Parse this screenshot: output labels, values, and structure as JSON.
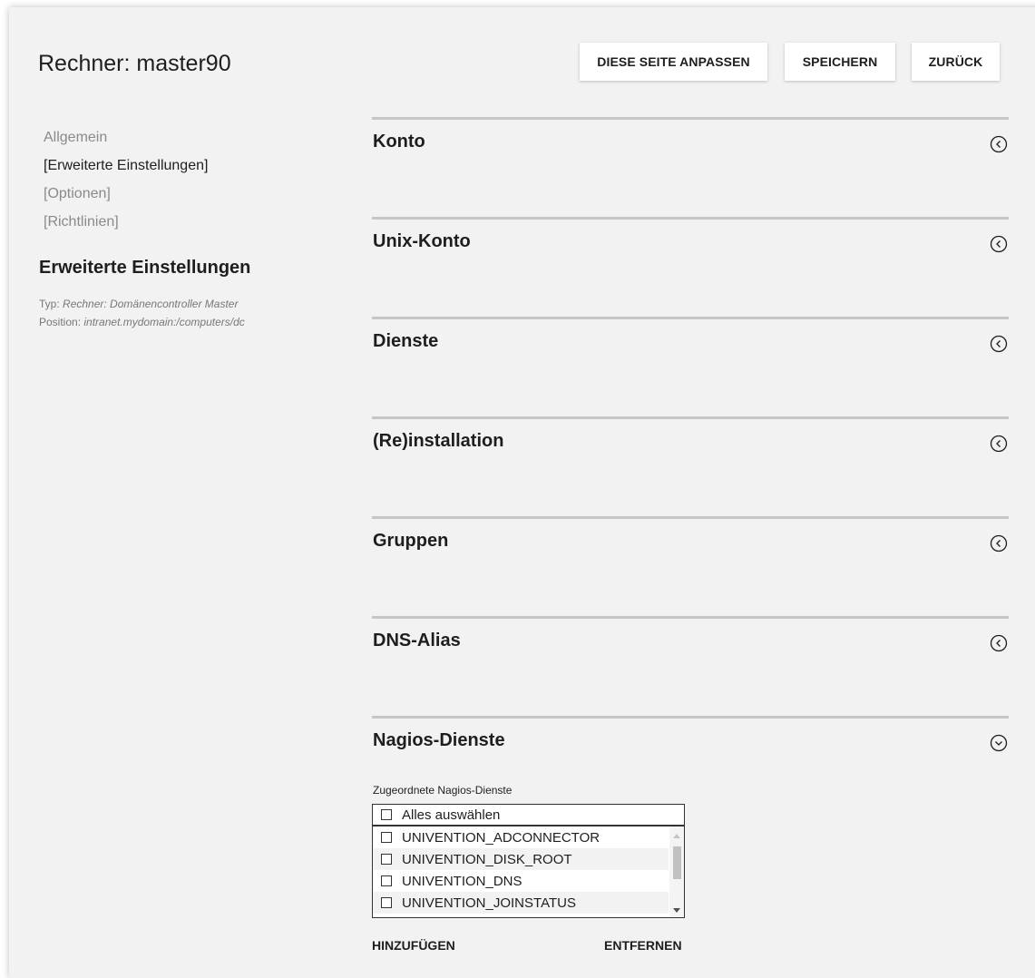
{
  "page": {
    "title": "Rechner: master90"
  },
  "toolbar": {
    "customize_label": "DIESE SEITE ANPASSEN",
    "save_label": "SPEICHERN",
    "back_label": "ZURÜCK"
  },
  "sidebar": {
    "items": [
      {
        "label": "Allgemein",
        "active": false
      },
      {
        "label": "[Erweiterte Einstellungen]",
        "active": true
      },
      {
        "label": "[Optionen]",
        "active": false
      },
      {
        "label": "[Richtlinien]",
        "active": false
      }
    ],
    "heading": "Erweiterte Einstellungen",
    "type_label": "Typ:",
    "type_value": "Rechner: Domänencontroller Master",
    "position_label": "Position:",
    "position_value": "intranet.mydomain:/computers/dc"
  },
  "sections": [
    {
      "title": "Konto",
      "expanded": false
    },
    {
      "title": "Unix-Konto",
      "expanded": false
    },
    {
      "title": "Dienste",
      "expanded": false
    },
    {
      "title": "(Re)installation",
      "expanded": false
    },
    {
      "title": "Gruppen",
      "expanded": false
    },
    {
      "title": "DNS-Alias",
      "expanded": false
    },
    {
      "title": "Nagios-Dienste",
      "expanded": true
    }
  ],
  "nagios": {
    "field_label": "Zugeordnete Nagios-Dienste",
    "select_all_label": "Alles auswählen",
    "options": [
      "UNIVENTION_ADCONNECTOR",
      "UNIVENTION_DISK_ROOT",
      "UNIVENTION_DNS",
      "UNIVENTION_JOINSTATUS"
    ],
    "add_label": "HINZUFÜGEN",
    "remove_label": "ENTFERNEN"
  },
  "colors": {
    "background": "#f2f2f2",
    "divider": "#c6c6c6",
    "text": "#1e1e1e",
    "muted_text": "#8a8a8a"
  },
  "icons": {
    "collapsed": "chevron-left-circle-icon",
    "expanded": "chevron-down-circle-icon"
  }
}
